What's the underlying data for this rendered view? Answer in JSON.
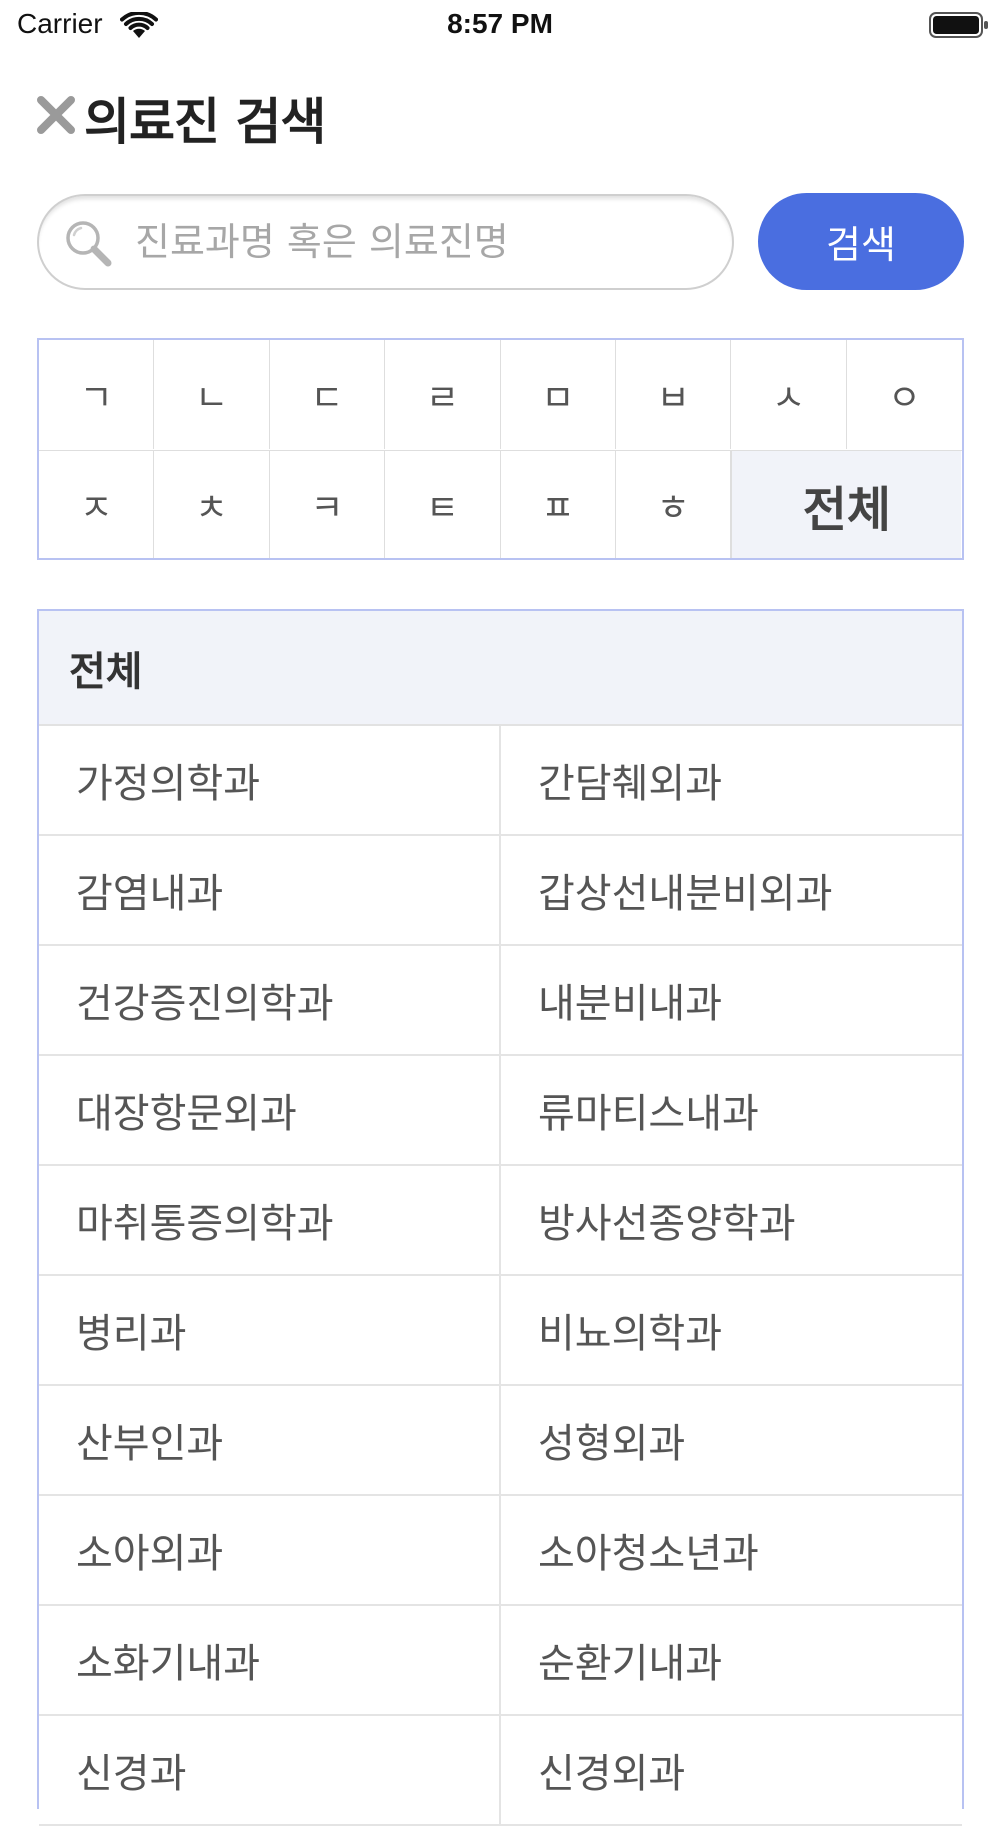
{
  "status_bar": {
    "carrier": "Carrier",
    "time": "8:57 PM"
  },
  "header": {
    "title": "의료진 검색"
  },
  "search": {
    "placeholder": "진료과명 혹은 의료진명",
    "value": "",
    "button_label": "검색"
  },
  "index": {
    "row1": [
      "ㄱ",
      "ㄴ",
      "ㄷ",
      "ㄹ",
      "ㅁ",
      "ㅂ",
      "ㅅ",
      "ㅇ"
    ],
    "row2": [
      "ㅈ",
      "ㅊ",
      "ㅋ",
      "ㅌ",
      "ㅍ",
      "ㅎ"
    ],
    "all_label": "전체",
    "selected": "전체"
  },
  "departments": {
    "header": "전체",
    "rows": [
      [
        "가정의학과",
        "간담췌외과"
      ],
      [
        "감염내과",
        "갑상선내분비외과"
      ],
      [
        "건강증진의학과",
        "내분비내과"
      ],
      [
        "대장항문외과",
        "류마티스내과"
      ],
      [
        "마취통증의학과",
        "방사선종양학과"
      ],
      [
        "병리과",
        "비뇨의학과"
      ],
      [
        "산부인과",
        "성형외과"
      ],
      [
        "소아외과",
        "소아청소년과"
      ],
      [
        "소화기내과",
        "순환기내과"
      ],
      [
        "신경과",
        "신경외과"
      ]
    ]
  },
  "colors": {
    "accent": "#4a6ee0",
    "grid_border": "#b8c2f2",
    "header_bg": "#f1f3f9"
  }
}
